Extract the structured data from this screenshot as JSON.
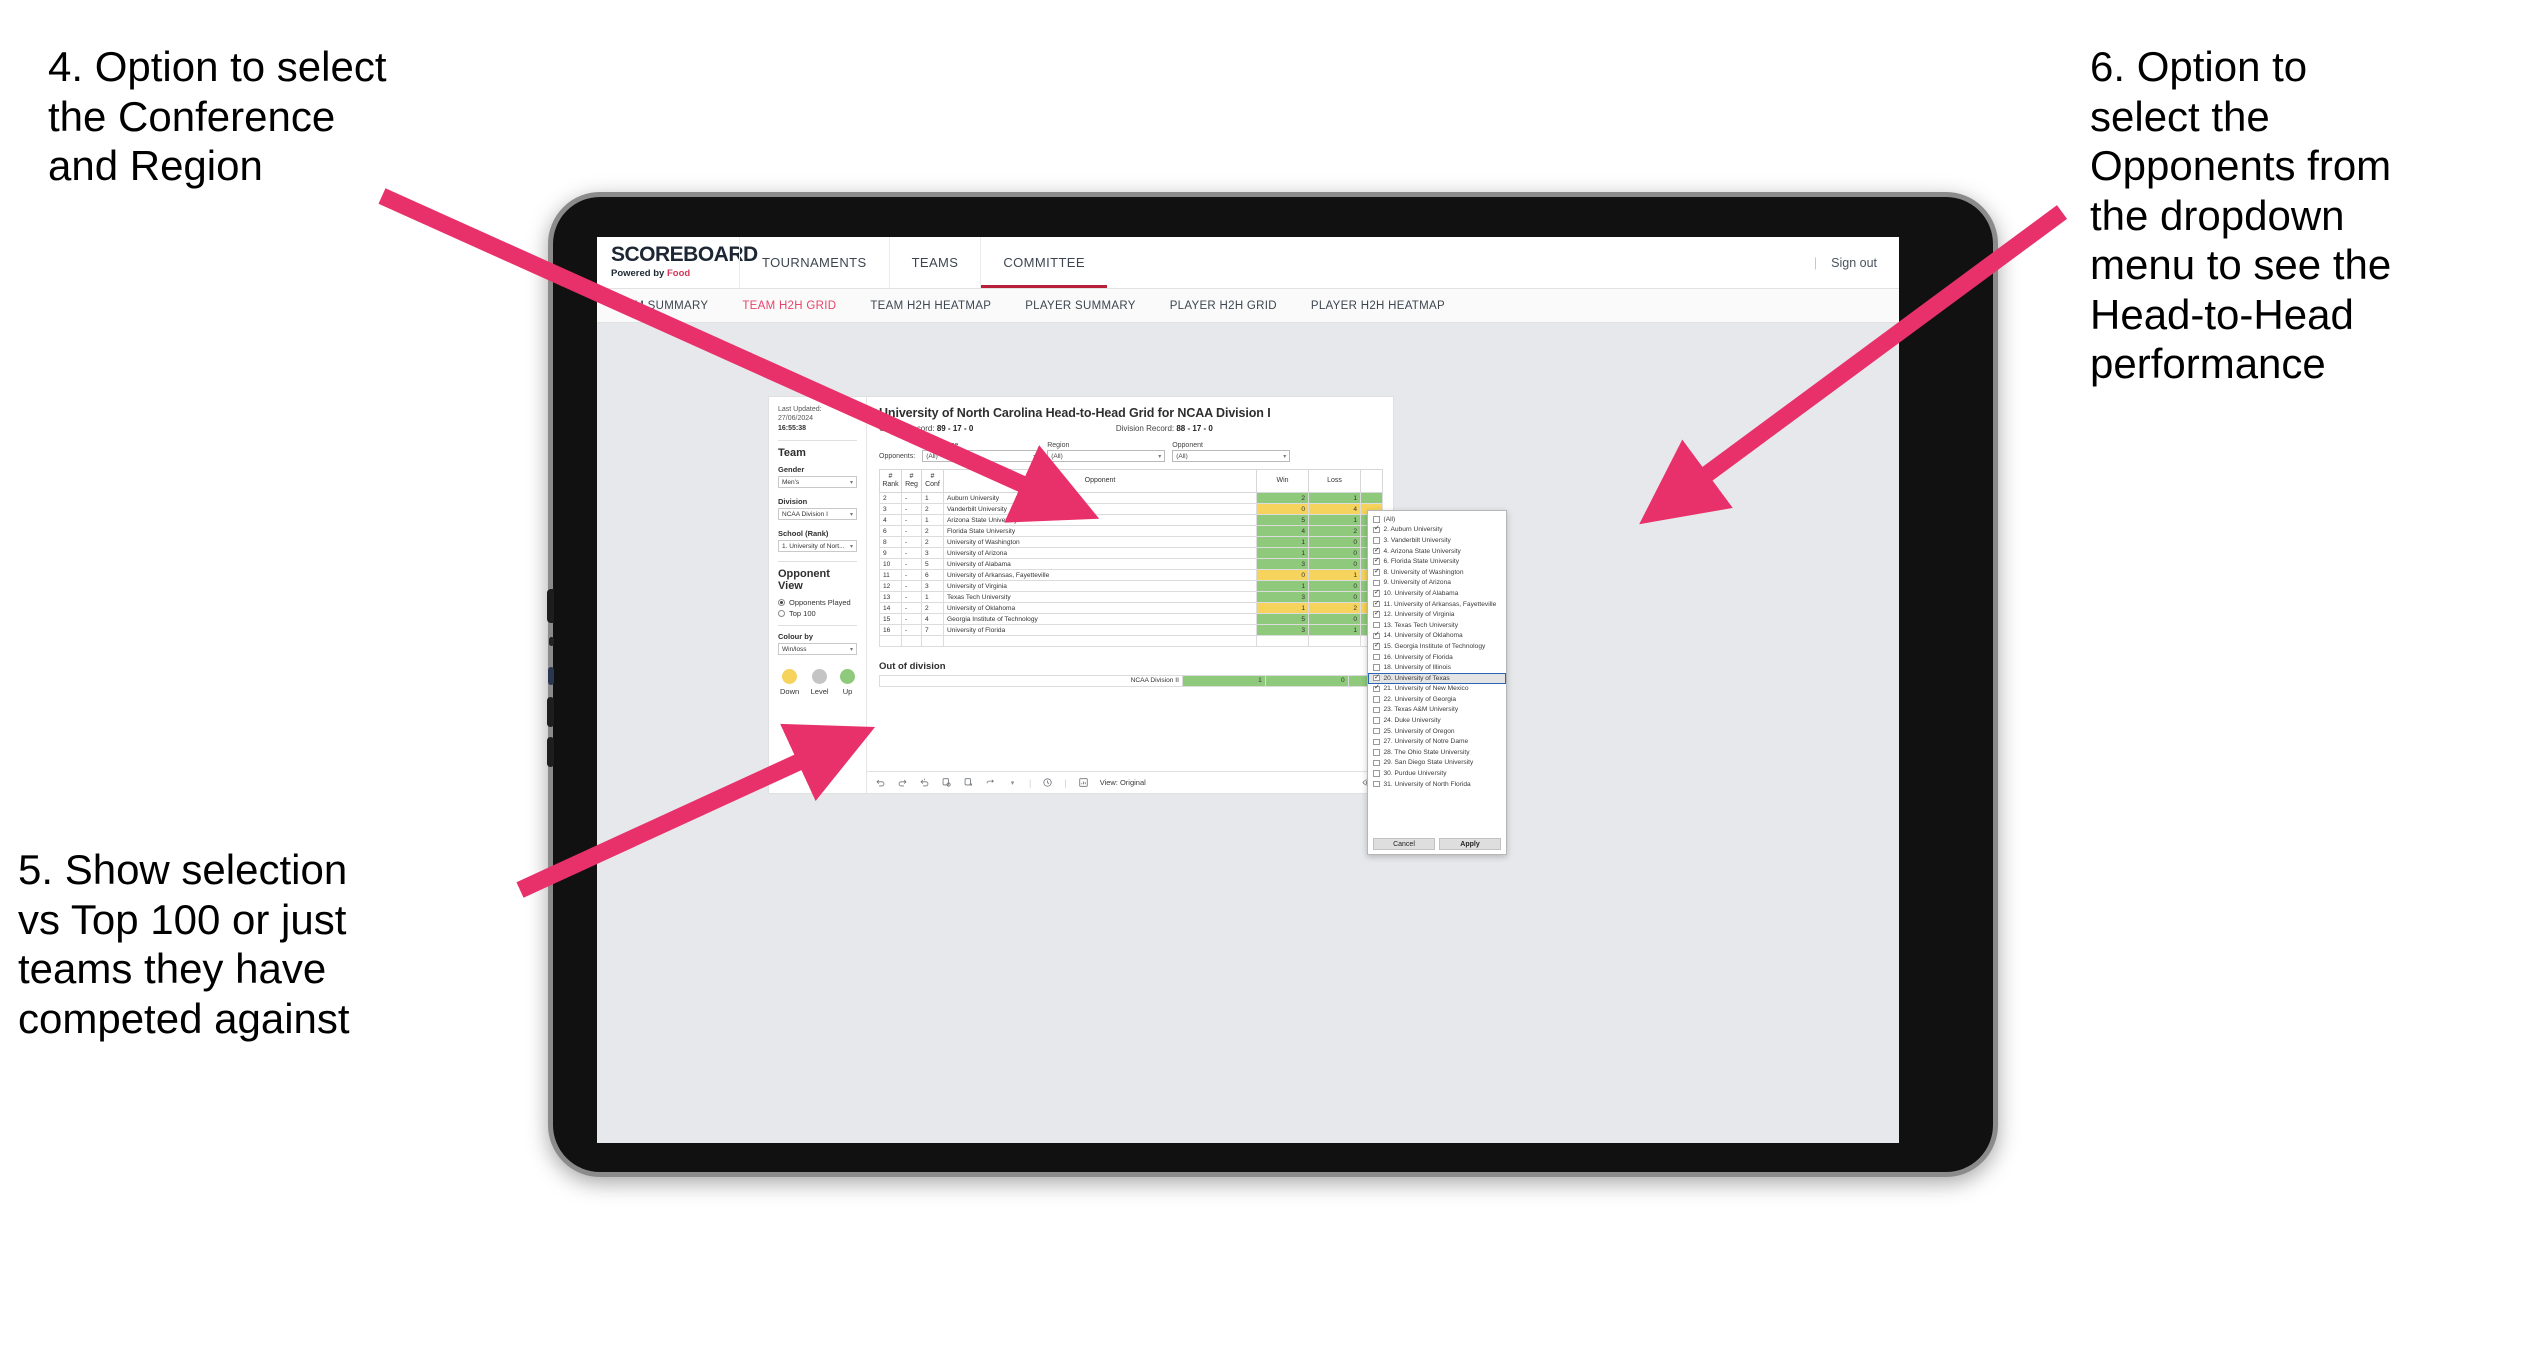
{
  "annotations": {
    "a4": "4. Option to select\nthe Conference\nand Region",
    "a5": "5. Show selection\nvs Top 100 or just\nteams they have\ncompeted against",
    "a6": "6. Option to\nselect the\nOpponents from\nthe dropdown\nmenu to see the\nHead-to-Head\nperformance",
    "arrow_color": "#E8316A"
  },
  "app": {
    "brand": {
      "name": "SCOREBOARD",
      "sub_prefix": "Powered by ",
      "sub_brand": "Food"
    },
    "topnav": [
      {
        "label": "TOURNAMENTS",
        "active": false
      },
      {
        "label": "TEAMS",
        "active": false
      },
      {
        "label": "COMMITTEE",
        "active": true
      }
    ],
    "signout": "Sign out",
    "divider": "|",
    "subnav": [
      {
        "label": "TEAM SUMMARY",
        "active": false
      },
      {
        "label": "TEAM H2H GRID",
        "active": true
      },
      {
        "label": "TEAM H2H HEATMAP",
        "active": false
      },
      {
        "label": "PLAYER SUMMARY",
        "active": false
      },
      {
        "label": "PLAYER H2H GRID",
        "active": false
      },
      {
        "label": "PLAYER H2H HEATMAP",
        "active": false
      }
    ]
  },
  "sidebar": {
    "last_updated_line1": "Last Updated: 27/06/2024",
    "last_updated_line2": "16:55:38",
    "team_title": "Team",
    "gender_label": "Gender",
    "gender_value": "Men's",
    "division_label": "Division",
    "division_value": "NCAA Division I",
    "school_label": "School (Rank)",
    "school_value": "1. University of Nort...",
    "opponent_view_title": "Opponent View",
    "radio_options": [
      {
        "label": "Opponents Played",
        "selected": true
      },
      {
        "label": "Top 100",
        "selected": false
      }
    ],
    "colour_by_label": "Colour by",
    "colour_by_value": "Win/loss",
    "legend": [
      {
        "label": "Down",
        "color": "#F5D35C"
      },
      {
        "label": "Level",
        "color": "#C4C4C4"
      },
      {
        "label": "Up",
        "color": "#8FCA7C"
      }
    ]
  },
  "viz": {
    "title": "University of North Carolina Head-to-Head Grid for NCAA Division I",
    "overall_record_label": "Overall Record:",
    "overall_record_value": "89 - 17 - 0",
    "division_record_label": "Division Record:",
    "division_record_value": "88 - 17 - 0",
    "opponents_prefix": "Opponents:",
    "filters": [
      {
        "label": "Conference",
        "value": "(All)"
      },
      {
        "label": "Region",
        "value": "(All)"
      },
      {
        "label": "Opponent",
        "value": "(All)"
      }
    ],
    "out_of_division_title": "Out of division",
    "out_of_division_row": {
      "name": "NCAA Division II",
      "win": "1",
      "loss": "0",
      "color": "#8FCA7C"
    }
  },
  "chart_data": {
    "type": "table",
    "title": "University of North Carolina Head-to-Head Grid for NCAA Division I",
    "columns": [
      "# Rank",
      "# Reg",
      "# Conf",
      "Opponent",
      "Win",
      "Loss"
    ],
    "header_cells": [
      {
        "l1": "#",
        "l2": "Rank"
      },
      {
        "l1": "#",
        "l2": "Reg"
      },
      {
        "l1": "#",
        "l2": "Conf"
      },
      {
        "l1": "",
        "l2": "Opponent"
      },
      {
        "l1": "",
        "l2": "Win"
      },
      {
        "l1": "",
        "l2": "Loss"
      }
    ],
    "rows": [
      {
        "rank": "2",
        "reg": "-",
        "conf": "1",
        "opponent": "Auburn University",
        "win": "2",
        "loss": "1",
        "state": "up"
      },
      {
        "rank": "3",
        "reg": "-",
        "conf": "2",
        "opponent": "Vanderbilt University",
        "win": "0",
        "loss": "4",
        "state": "down"
      },
      {
        "rank": "4",
        "reg": "-",
        "conf": "1",
        "opponent": "Arizona State University",
        "win": "5",
        "loss": "1",
        "state": "up"
      },
      {
        "rank": "6",
        "reg": "-",
        "conf": "2",
        "opponent": "Florida State University",
        "win": "4",
        "loss": "2",
        "state": "up"
      },
      {
        "rank": "8",
        "reg": "-",
        "conf": "2",
        "opponent": "University of Washington",
        "win": "1",
        "loss": "0",
        "state": "up"
      },
      {
        "rank": "9",
        "reg": "-",
        "conf": "3",
        "opponent": "University of Arizona",
        "win": "1",
        "loss": "0",
        "state": "up"
      },
      {
        "rank": "10",
        "reg": "-",
        "conf": "5",
        "opponent": "University of Alabama",
        "win": "3",
        "loss": "0",
        "state": "up"
      },
      {
        "rank": "11",
        "reg": "-",
        "conf": "6",
        "opponent": "University of Arkansas, Fayetteville",
        "win": "0",
        "loss": "1",
        "state": "down"
      },
      {
        "rank": "12",
        "reg": "-",
        "conf": "3",
        "opponent": "University of Virginia",
        "win": "1",
        "loss": "0",
        "state": "up"
      },
      {
        "rank": "13",
        "reg": "-",
        "conf": "1",
        "opponent": "Texas Tech University",
        "win": "3",
        "loss": "0",
        "state": "up"
      },
      {
        "rank": "14",
        "reg": "-",
        "conf": "2",
        "opponent": "University of Oklahoma",
        "win": "1",
        "loss": "2",
        "state": "down"
      },
      {
        "rank": "15",
        "reg": "-",
        "conf": "4",
        "opponent": "Georgia Institute of Technology",
        "win": "5",
        "loss": "0",
        "state": "up"
      },
      {
        "rank": "16",
        "reg": "-",
        "conf": "7",
        "opponent": "University of Florida",
        "win": "3",
        "loss": "1",
        "state": "up"
      }
    ],
    "colors": {
      "up": "#8FCA7C",
      "down": "#F5D35C",
      "level": "#C4C4C4"
    }
  },
  "opponent_dropdown": {
    "items": [
      {
        "label": "(All)",
        "checked": false,
        "selected": false
      },
      {
        "label": "2. Auburn University",
        "checked": true,
        "selected": false
      },
      {
        "label": "3. Vanderbilt University",
        "checked": false,
        "selected": false
      },
      {
        "label": "4. Arizona State University",
        "checked": true,
        "selected": false
      },
      {
        "label": "6. Florida State University",
        "checked": true,
        "selected": false
      },
      {
        "label": "8. University of Washington",
        "checked": true,
        "selected": false
      },
      {
        "label": "9. University of Arizona",
        "checked": false,
        "selected": false
      },
      {
        "label": "10. University of Alabama",
        "checked": true,
        "selected": false
      },
      {
        "label": "11. University of Arkansas, Fayetteville",
        "checked": true,
        "selected": false
      },
      {
        "label": "12. University of Virginia",
        "checked": true,
        "selected": false
      },
      {
        "label": "13. Texas Tech University",
        "checked": false,
        "selected": false
      },
      {
        "label": "14. University of Oklahoma",
        "checked": true,
        "selected": false
      },
      {
        "label": "15. Georgia Institute of Technology",
        "checked": true,
        "selected": false
      },
      {
        "label": "16. University of Florida",
        "checked": false,
        "selected": false
      },
      {
        "label": "18. University of Illinois",
        "checked": false,
        "selected": false
      },
      {
        "label": "20. University of Texas",
        "checked": true,
        "selected": true
      },
      {
        "label": "21. University of New Mexico",
        "checked": true,
        "selected": false
      },
      {
        "label": "22. University of Georgia",
        "checked": false,
        "selected": false
      },
      {
        "label": "23. Texas A&M University",
        "checked": false,
        "selected": false
      },
      {
        "label": "24. Duke University",
        "checked": false,
        "selected": false
      },
      {
        "label": "25. University of Oregon",
        "checked": false,
        "selected": false
      },
      {
        "label": "27. University of Notre Dame",
        "checked": false,
        "selected": false
      },
      {
        "label": "28. The Ohio State University",
        "checked": false,
        "selected": false
      },
      {
        "label": "29. San Diego State University",
        "checked": false,
        "selected": false
      },
      {
        "label": "30. Purdue University",
        "checked": false,
        "selected": false
      },
      {
        "label": "31. University of North Florida",
        "checked": false,
        "selected": false
      }
    ],
    "cancel_label": "Cancel",
    "apply_label": "Apply"
  },
  "toolbar": {
    "view_label": "View: Original",
    "watch_label": "W",
    "separator": "|"
  }
}
